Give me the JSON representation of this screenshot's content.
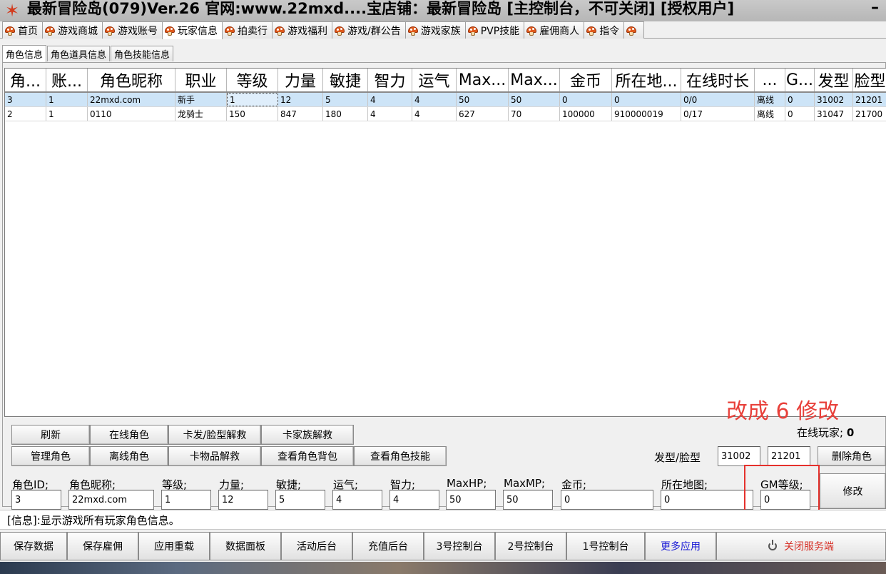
{
  "window": {
    "title": "最新冒险岛(079)Ver.26 官网:www.22mxd....宝店铺：最新冒险岛 [主控制台，不可关闭] [授权用户]",
    "minimize": "–"
  },
  "main_tabs": [
    {
      "label": "首页"
    },
    {
      "label": "游戏商城"
    },
    {
      "label": "游戏账号"
    },
    {
      "label": "玩家信息",
      "active": true
    },
    {
      "label": "拍卖行"
    },
    {
      "label": "游戏福利"
    },
    {
      "label": "游戏/群公告"
    },
    {
      "label": "游戏家族"
    },
    {
      "label": "PVP技能"
    },
    {
      "label": "雇佣商人"
    },
    {
      "label": "指令"
    },
    {
      "label": ""
    }
  ],
  "sub_tabs": [
    {
      "label": "角色信息",
      "active": true
    },
    {
      "label": "角色道具信息"
    },
    {
      "label": "角色技能信息"
    }
  ],
  "grid": {
    "columns": [
      "角...",
      "账...",
      "角色昵称",
      "职业",
      "等级",
      "力量",
      "敏捷",
      "智力",
      "运气",
      "Max...",
      "Max...",
      "金币",
      "所在地...",
      "在线时长",
      "...",
      "G...",
      "发型",
      "脸型"
    ],
    "rows": [
      [
        "3",
        "1",
        "22mxd.com",
        "新手",
        "1",
        "12",
        "5",
        "4",
        "4",
        "50",
        "50",
        "0",
        "0",
        "0/0",
        "离线",
        "0",
        "31002",
        "21201"
      ],
      [
        "2",
        "1",
        "0110",
        "龙骑士",
        "150",
        "847",
        "180",
        "4",
        "4",
        "627",
        "70",
        "100000",
        "910000019",
        "0/17",
        "离线",
        "0",
        "31047",
        "21700"
      ]
    ],
    "selected_row": 0
  },
  "buttons_row1": [
    "刷新",
    "在线角色",
    "卡发/脸型解救",
    "卡家族解救"
  ],
  "buttons_row2": [
    "管理角色",
    "离线角色",
    "卡物品解救",
    "查看角色背包",
    "查看角色技能"
  ],
  "annotation": "改成  6 修改",
  "online": {
    "label": "在线玩家;",
    "count": "0"
  },
  "hair_face": {
    "label": "发型/脸型",
    "hair": "31002",
    "face": "21201",
    "delete_button": "删除角色"
  },
  "edit_form": {
    "fields": [
      {
        "label": "角色ID;",
        "value": "3"
      },
      {
        "label": "角色昵称;",
        "value": "22mxd.com"
      },
      {
        "label": "等级;",
        "value": "1"
      },
      {
        "label": "力量;",
        "value": "12"
      },
      {
        "label": "敏捷;",
        "value": "5"
      },
      {
        "label": "运气;",
        "value": "4"
      },
      {
        "label": "智力;",
        "value": "4"
      },
      {
        "label": "MaxHP;",
        "value": "50"
      },
      {
        "label": "MaxMP;",
        "value": "50"
      },
      {
        "label": "金币;",
        "value": "0"
      },
      {
        "label": "所在地图;",
        "value": "0"
      },
      {
        "label": "GM等级;",
        "value": "0"
      }
    ],
    "modify_button": "修改"
  },
  "info_text": "[信息]:显示游戏所有玩家角色信息。",
  "bottom_buttons": [
    "保存数据",
    "保存雇佣",
    "应用重载",
    "数据面板",
    "活动后台",
    "充值后台",
    "3号控制台",
    "2号控制台",
    "1号控制台",
    "更多应用",
    "关闭服务端"
  ]
}
